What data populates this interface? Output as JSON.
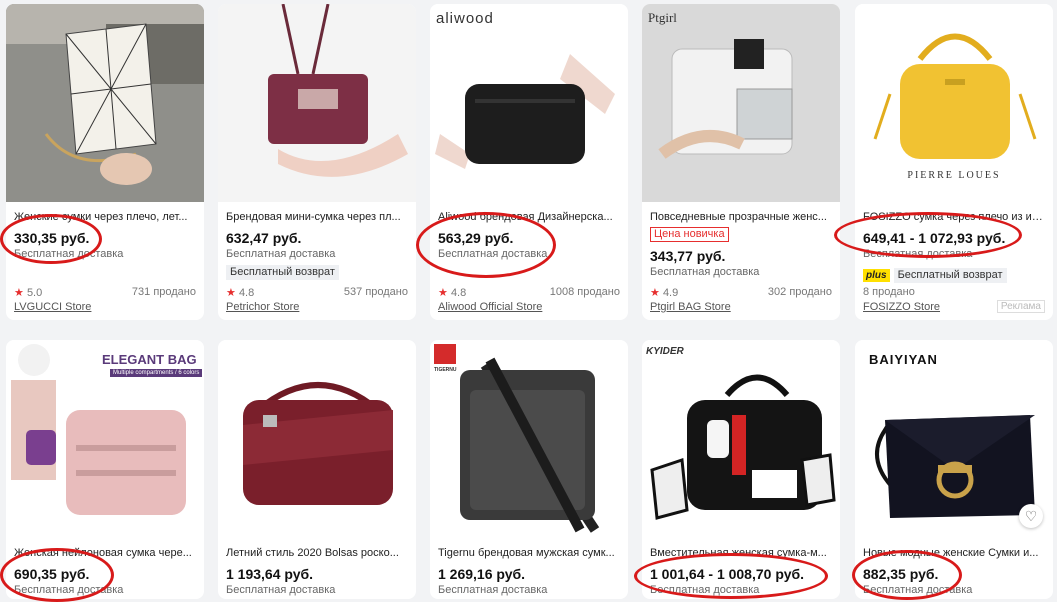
{
  "colors": {
    "accent_red": "#d81a1a",
    "star": "#e62e2e",
    "plus_yellow": "#ffe000"
  },
  "products": [
    {
      "title": "Женские сумки через плечо, лет...",
      "price": "330,35 руб.",
      "shipping": "Бесплатная доставка",
      "rating": "5.0",
      "sold": "731 продано",
      "store": "LVGUCCI Store"
    },
    {
      "title": "Брендовая мини-сумка через пл...",
      "price": "632,47 руб.",
      "shipping": "Бесплатная доставка",
      "badge": "Бесплатный возврат",
      "rating": "4.8",
      "sold": "537 продано",
      "store": "Petrichor Store"
    },
    {
      "title": "Aliwood брендовая Дизайнерска...",
      "price": "563,29 руб.",
      "shipping": "Бесплатная доставка",
      "rating": "4.8",
      "sold": "1008 продано",
      "store": "Aliwood Official Store",
      "brand": "aliwood"
    },
    {
      "title": "Повседневные прозрачные женс...",
      "novice": "Цена новичка",
      "price": "343,77 руб.",
      "shipping": "Бесплатная доставка",
      "rating": "4.9",
      "sold": "302 продано",
      "store": "Ptgirl BAG Store",
      "brand": "Ptgirl"
    },
    {
      "title": "FOSIZZO сумка через плечо из ис...",
      "price": "649,41 - 1 072,93 руб.",
      "shipping": "Бесплатная доставка",
      "plus": "plus",
      "badge": "Бесплатный возврат",
      "sold": "8 продано",
      "store": "FOSIZZO Store",
      "ad": "Реклама",
      "brand": "PIERRE LOUES"
    },
    {
      "title": "Женская нейлоновая сумка чере...",
      "price": "690,35 руб.",
      "shipping": "Бесплатная доставка",
      "brand": "ELEGANT BAG",
      "brand_sub": "Multiple compartments / 6 colors"
    },
    {
      "title": "Летний стиль 2020 Bolsas роско...",
      "price": "1 193,64 руб.",
      "shipping": "Бесплатная доставка"
    },
    {
      "title": "Tigernu брендовая мужская сумк...",
      "price": "1 269,16 руб.",
      "shipping": "Бесплатная доставка",
      "brand": "TIGERNU"
    },
    {
      "title": "Вместительная женская сумка-м...",
      "price": "1 001,64 - 1 008,70 руб.",
      "shipping": "Бесплатная доставка",
      "brand": "KYIDER"
    },
    {
      "title": "Новые модные женские Сумки и...",
      "price": "882,35 руб.",
      "shipping": "Бесплатная доставка",
      "brand": "BAIYIYAN"
    }
  ]
}
